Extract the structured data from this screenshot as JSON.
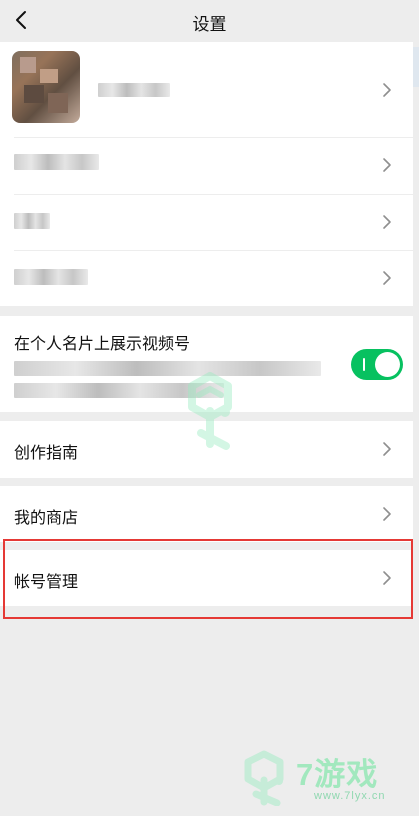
{
  "nav": {
    "title": "设置",
    "back_icon": "back-icon"
  },
  "sections": {
    "channel_display": {
      "toggle_label": "在个人名片上展示视频号",
      "toggle_state": "on"
    },
    "creation_guide": {
      "label": "创作指南"
    },
    "my_store": {
      "label": "我的商店"
    },
    "account_management": {
      "label": "帐号管理"
    }
  },
  "watermark": {
    "brand": "7游戏",
    "url": "www.7lyx.cn"
  },
  "colors": {
    "background": "#ededed",
    "card": "#ffffff",
    "toggle": "#07c160",
    "highlight": "#e53935",
    "watermark": "#8fe6b5"
  },
  "icons": {
    "back": "back-icon",
    "chevron": "chevron-right-icon"
  }
}
